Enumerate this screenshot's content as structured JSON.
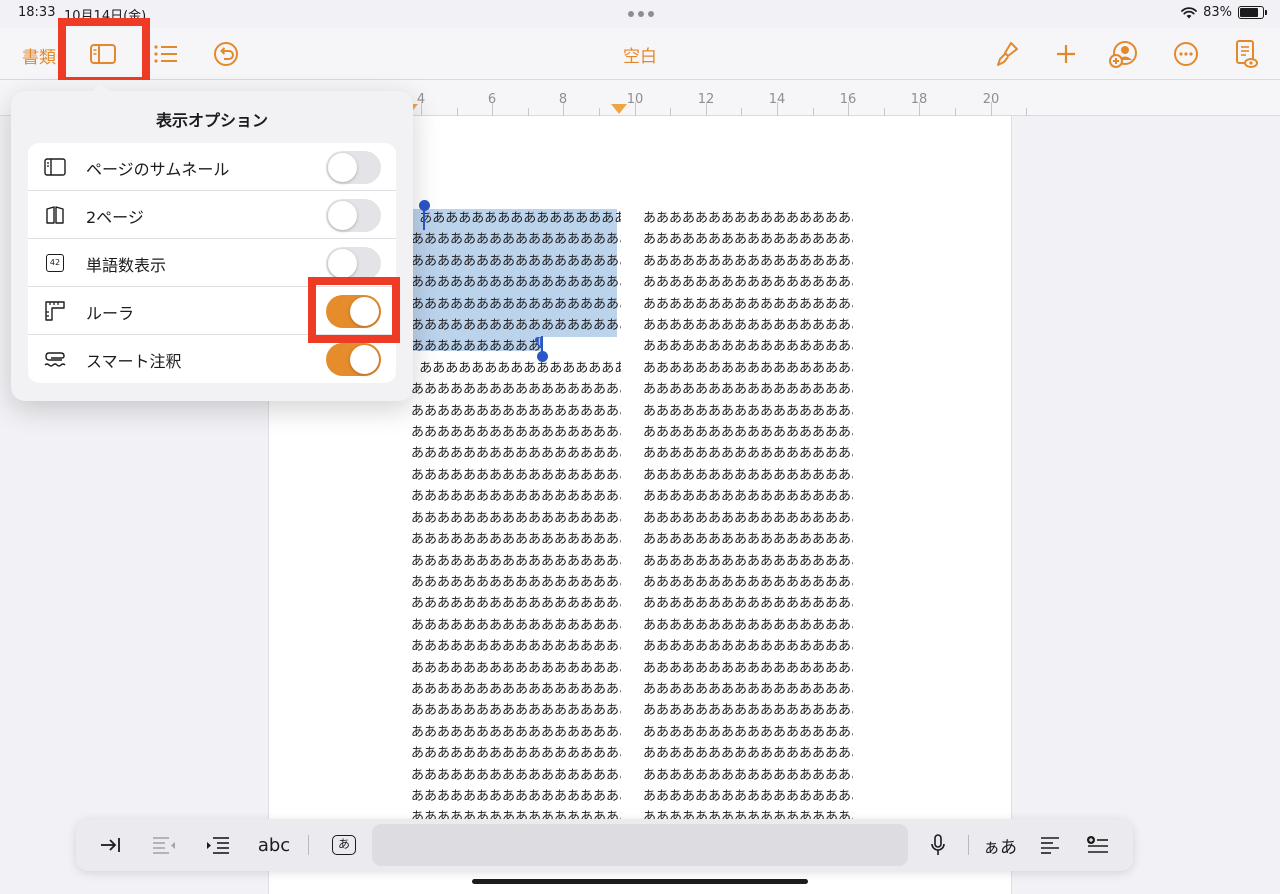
{
  "status_bar": {
    "time": "18:33",
    "date": "10月14日(金)",
    "battery": "83%",
    "battery_level": 0.83
  },
  "toolbar": {
    "documents_label": "書類",
    "title": "空白",
    "icons": {
      "sidebar": "sidebar-icon",
      "list": "list-icon",
      "undo": "undo-icon",
      "format": "paintbrush-icon",
      "insert": "plus-icon",
      "collaborate": "add-person-icon",
      "more": "ellipsis-icon",
      "doc_options": "document-preview-icon"
    }
  },
  "ruler": {
    "labels": [
      "4",
      "6",
      "8",
      "10",
      "12",
      "14",
      "16",
      "18",
      "20"
    ]
  },
  "view_options": {
    "title": "表示オプション",
    "rows": [
      {
        "label": "ページのサムネール",
        "icon": "page-thumbnail-icon",
        "on": false
      },
      {
        "label": "2ページ",
        "icon": "two-pages-icon",
        "on": false
      },
      {
        "label": "単語数表示",
        "icon": "word-count-icon",
        "icon_text": "42",
        "on": false
      },
      {
        "label": "ルーラ",
        "icon": "ruler-icon",
        "on": true
      },
      {
        "label": "スマート注釈",
        "icon": "smart-annotation-icon",
        "on": true
      }
    ]
  },
  "document": {
    "line_text": "ああああああああああああああああああ",
    "first_line_text": "あああああああああああああああああ",
    "selection_last_line": "ああああああああああ",
    "column1_lines": 30,
    "column2_lines": 30
  },
  "keyboard_bar": {
    "spellcheck_label": "abc",
    "kana_label": "あ",
    "font_size_label": "ぁあ"
  },
  "colors": {
    "accent": "#e3892c",
    "toggle_on": "#e58c2d",
    "highlight_box": "#ee3b25",
    "selection": "#bcd3ec",
    "selection_handle": "#2a56c6"
  }
}
